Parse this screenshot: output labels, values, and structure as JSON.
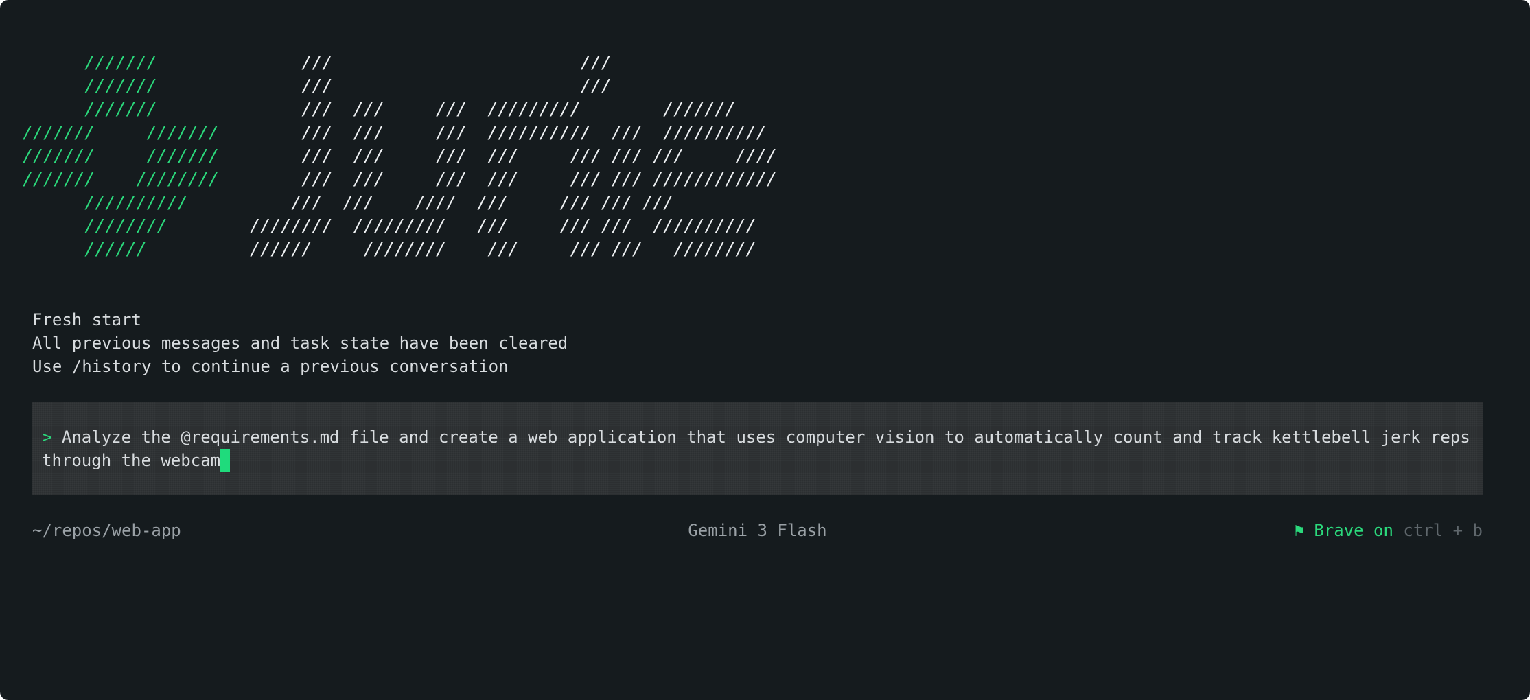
{
  "logo": {
    "lines": [
      {
        "green": "      ///////",
        "white": "              ///                        ///"
      },
      {
        "green": "      ///////",
        "white": "              ///                        ///"
      },
      {
        "green": "      ///////",
        "white": "              ///  ///     ///  /////////        ///////"
      },
      {
        "green": "///////     ///////",
        "white": "        ///  ///     ///  //////////  ///  //////////"
      },
      {
        "green": "///////     ///////",
        "white": "        ///  ///     ///  ///     /// /// ///     ////"
      },
      {
        "green": "///////    ////////",
        "white": "        ///  ///     ///  ///     /// /// ////////////"
      },
      {
        "green": "      //////////",
        "white": "          ///  ///    ////  ///     /// /// ///"
      },
      {
        "green": "      ////////",
        "white": "        ////////  /////////   ///     /// ///  //////////"
      },
      {
        "green": "      //////",
        "white": "          //////     ////////    ///     /// ///   ////////"
      }
    ]
  },
  "info": {
    "line1": "Fresh start",
    "line2": "All previous messages and task state have been cleared",
    "line3": "Use /history to continue a previous conversation"
  },
  "prompt": {
    "marker": ">",
    "text": "Analyze the @requirements.md file and create a web application that uses computer vision to automatically count and track kettlebell jerk reps through the webcam"
  },
  "status": {
    "cwd": "~/repos/web-app",
    "model": "Gemini 3 Flash",
    "flag_icon": "⚑",
    "brave_label": "Brave on",
    "shortcut": "ctrl + b"
  },
  "colors": {
    "background": "#151b1e",
    "accent": "#2bd97c",
    "text": "#d8dcdf",
    "muted": "#9aa1a6"
  }
}
